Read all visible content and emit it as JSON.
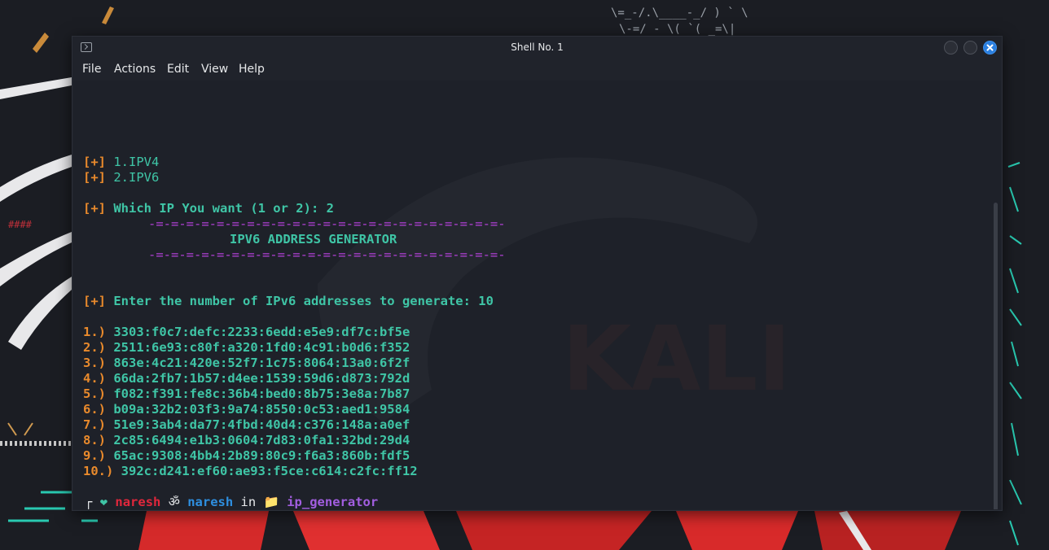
{
  "window": {
    "title": "Shell No. 1",
    "menu": [
      "File",
      "Actions",
      "Edit",
      "View",
      "Help"
    ]
  },
  "terminal": {
    "menu_options": [
      {
        "prefix": "[+]",
        "text": "1.IPV4"
      },
      {
        "prefix": "[+]",
        "text": "2.IPV6"
      }
    ],
    "question": {
      "prefix": "[+]",
      "text": "Which IP You want (1 or 2): 2"
    },
    "banner": {
      "rule": "-=-=-=-=-=-=-=-=-=-=-=-=-=-=-=-=-=-=-=-=-=-=-=-",
      "heading": "IPV6 ADDRESS GENERATOR"
    },
    "count_prompt": {
      "prefix": "[+]",
      "text": "Enter the number of IPv6 addresses to generate: 10"
    },
    "addresses": [
      {
        "index": "1.)",
        "value": "3303:f0c7:defc:2233:6edd:e5e9:df7c:bf5e"
      },
      {
        "index": "2.)",
        "value": "2511:6e93:c80f:a320:1fd0:4c91:b0d6:f352"
      },
      {
        "index": "3.)",
        "value": "863e:4c21:420e:52f7:1c75:8064:13a0:6f2f"
      },
      {
        "index": "4.)",
        "value": "66da:2fb7:1b57:d4ee:1539:59d6:d873:792d"
      },
      {
        "index": "5.)",
        "value": "f082:f391:fe8c:36b4:bed0:8b75:3e8a:7b87"
      },
      {
        "index": "6.)",
        "value": "b09a:32b2:03f3:9a74:8550:0c53:aed1:9584"
      },
      {
        "index": "7.)",
        "value": "51e9:3ab4:da77:4fbd:40d4:c376:148a:a0ef"
      },
      {
        "index": "8.)",
        "value": "2c85:6494:e1b3:0604:7d83:0fa1:32bd:29d4"
      },
      {
        "index": "9.)",
        "value": "65ac:9308:4bb4:2b89:80c9:f6a3:860b:fdf5"
      },
      {
        "index": "10.)",
        "value": "392c:d241:ef60:ae93:f5ce:c614:c2fc:ff12"
      }
    ],
    "shell_prompt": {
      "heart": "❤",
      "user": "naresh",
      "om": "ॐ",
      "host": "naresh",
      "in": "in",
      "folder_icon": "📁",
      "directory": "ip_generator",
      "arrow": "❯"
    }
  },
  "colors": {
    "prefix": "#e98a2c",
    "text": "#3fc5a6",
    "rule": "#b341d8",
    "user": "#e0273c",
    "host": "#2e8fe0",
    "directory": "#a25ee0",
    "close_button": "#2a7fe0"
  }
}
